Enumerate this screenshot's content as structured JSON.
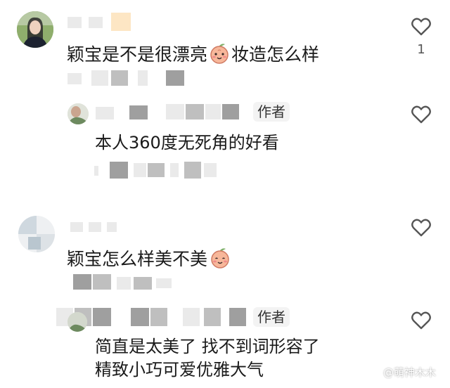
{
  "comments": [
    {
      "text_before_emoji": "颖宝是不是很漂亮",
      "text_after_emoji": "妆造怎么样",
      "like_count": "1",
      "reply": {
        "author_tag": "作者",
        "text": "本人360度无死角的好看"
      }
    },
    {
      "text_before_emoji": "颖宝怎么样美不美",
      "like_count": "",
      "reply": {
        "author_tag": "作者",
        "line1": "简直是太美了 找不到词形容了",
        "line2": "精致小巧可爱优雅大气"
      }
    }
  ],
  "icons": {
    "like": "heart-outline-icon",
    "emoji": "peach-face-emoji"
  },
  "watermark": "@萌神木木",
  "colors": {
    "background": "#ffffff",
    "text": "#1a1a1a",
    "heart_outline": "#555555",
    "author_tag_bg": "#f3f3f3",
    "emoji_peach": "#f7b79a"
  }
}
